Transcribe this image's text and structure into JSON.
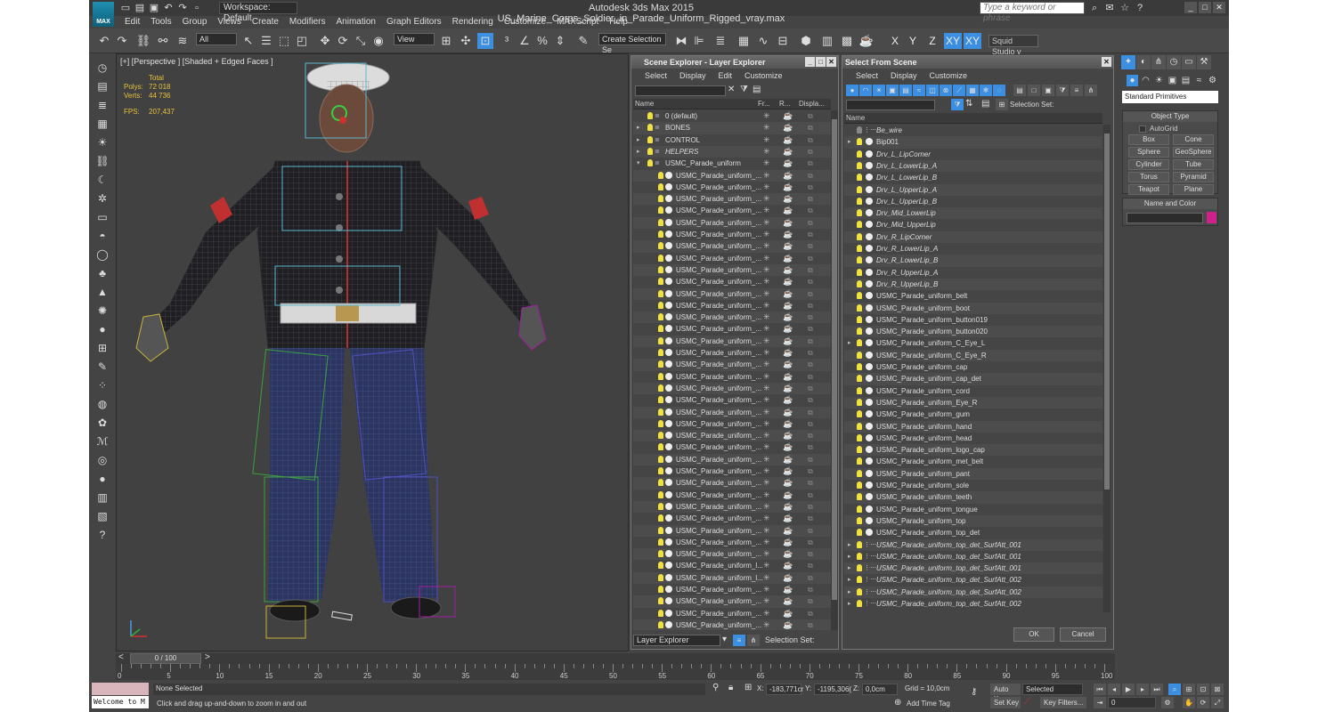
{
  "app": {
    "logo_text": "MAX",
    "workspace": "Workspace: Default",
    "window_title": "Autodesk 3ds Max  2015     US_Marine_Corps_Soldier_in_Parade_Uniform_Rigged_vray.max",
    "search_placeholder": "Type a keyword or phrase"
  },
  "menu": [
    "Edit",
    "Tools",
    "Group",
    "Views",
    "Create",
    "Modifiers",
    "Animation",
    "Graph Editors",
    "Rendering",
    "Customize",
    "MAXScript",
    "Help"
  ],
  "toolbar": {
    "filter": "All",
    "coord": "View",
    "selection_set": "Create Selection Se",
    "axes": [
      "X",
      "Y",
      "Z",
      "XY",
      "XY"
    ],
    "squid": "Squid Studio v"
  },
  "viewport": {
    "label": "[+] [Perspective ] [Shaded + Edged Faces ]",
    "stats_total": "Total",
    "polys_label": "Polys:",
    "polys": "72 018",
    "verts_label": "Verts:",
    "verts": "44 736",
    "fps_label": "FPS:",
    "fps": "207,437"
  },
  "scene_explorer": {
    "title": "Scene Explorer - Layer Explorer",
    "menu": [
      "Select",
      "Display",
      "Edit",
      "Customize"
    ],
    "columns": [
      "Name",
      "Fr...",
      "R...",
      "Displa..."
    ],
    "rows": [
      {
        "name": "0 (default)",
        "level": 0,
        "icon": "layer",
        "expand": false
      },
      {
        "name": "BONES",
        "level": 0,
        "icon": "layer",
        "expand": true
      },
      {
        "name": "CONTROL",
        "level": 0,
        "icon": "layer",
        "expand": true
      },
      {
        "name": "HELPERS",
        "level": 0,
        "icon": "layer",
        "expand": true,
        "italic": true
      },
      {
        "name": "USMC_Parade_uniform",
        "level": 0,
        "icon": "layer",
        "expand": true,
        "open": true
      },
      {
        "name": "USMC_Parade_uniform_...",
        "level": 1
      },
      {
        "name": "USMC_Parade_uniform_...",
        "level": 1
      },
      {
        "name": "USMC_Parade_uniform_...",
        "level": 1
      },
      {
        "name": "USMC_Parade_uniform_...",
        "level": 1
      },
      {
        "name": "USMC_Parade_uniform_...",
        "level": 1
      },
      {
        "name": "USMC_Parade_uniform_...",
        "level": 1
      },
      {
        "name": "USMC_Parade_uniform_...",
        "level": 1
      },
      {
        "name": "USMC_Parade_uniform_...",
        "level": 1
      },
      {
        "name": "USMC_Parade_uniform_...",
        "level": 1
      },
      {
        "name": "USMC_Parade_uniform_...",
        "level": 1
      },
      {
        "name": "USMC_Parade_uniform_...",
        "level": 1
      },
      {
        "name": "USMC_Parade_uniform_...",
        "level": 1
      },
      {
        "name": "USMC_Parade_uniform_...",
        "level": 1
      },
      {
        "name": "USMC_Parade_uniform_...",
        "level": 1
      },
      {
        "name": "USMC_Parade_uniform_...",
        "level": 1
      },
      {
        "name": "USMC_Parade_uniform_...",
        "level": 1
      },
      {
        "name": "USMC_Parade_uniform_...",
        "level": 1
      },
      {
        "name": "USMC_Parade_uniform_...",
        "level": 1
      },
      {
        "name": "USMC_Parade_uniform_...",
        "level": 1
      },
      {
        "name": "USMC_Parade_uniform_...",
        "level": 1
      },
      {
        "name": "USMC_Parade_uniform_...",
        "level": 1
      },
      {
        "name": "USMC_Parade_uniform_...",
        "level": 1
      },
      {
        "name": "USMC_Parade_uniform_...",
        "level": 1
      },
      {
        "name": "USMC_Parade_uniform_...",
        "level": 1
      },
      {
        "name": "USMC_Parade_uniform_...",
        "level": 1
      },
      {
        "name": "USMC_Parade_uniform_...",
        "level": 1
      },
      {
        "name": "USMC_Parade_uniform_...",
        "level": 1
      },
      {
        "name": "USMC_Parade_uniform_...",
        "level": 1
      },
      {
        "name": "USMC_Parade_uniform_...",
        "level": 1
      },
      {
        "name": "USMC_Parade_uniform_...",
        "level": 1
      },
      {
        "name": "USMC_Parade_uniform_...",
        "level": 1
      },
      {
        "name": "USMC_Parade_uniform_...",
        "level": 1
      },
      {
        "name": "USMC_Parade_uniform_...",
        "level": 1
      },
      {
        "name": "USMC_Parade_uniform_l...",
        "level": 1
      },
      {
        "name": "USMC_Parade_uniform_l...",
        "level": 1
      },
      {
        "name": "USMC_Parade_uniform_...",
        "level": 1
      },
      {
        "name": "USMC_Parade_uniform_...",
        "level": 1
      },
      {
        "name": "USMC_Parade_uniform_...",
        "level": 1
      },
      {
        "name": "USMC_Parade_uniform_...",
        "level": 1
      }
    ],
    "footer_dropdown": "Layer Explorer",
    "footer_selection": "Selection Set:"
  },
  "select_scene": {
    "title": "Select From Scene",
    "menu": [
      "Select",
      "Display",
      "Customize"
    ],
    "selection_set_label": "Selection Set:",
    "column": "Name",
    "rows": [
      {
        "name": "Be_wire",
        "italic": true,
        "kind": "helper"
      },
      {
        "name": "Bip001",
        "kind": "bone",
        "expand": true
      },
      {
        "name": "Drv_L_LipCorner",
        "italic": true,
        "kind": "bone"
      },
      {
        "name": "Drv_L_LowerLip_A",
        "italic": true,
        "kind": "bone"
      },
      {
        "name": "Drv_L_LowerLip_B",
        "italic": true,
        "kind": "bone"
      },
      {
        "name": "Drv_L_UpperLip_A",
        "italic": true,
        "kind": "bone"
      },
      {
        "name": "Drv_L_UpperLip_B",
        "italic": true,
        "kind": "bone"
      },
      {
        "name": "Drv_Mid_LowerLip",
        "italic": true,
        "kind": "bone"
      },
      {
        "name": "Drv_Mid_UpperLip",
        "italic": true,
        "kind": "bone"
      },
      {
        "name": "Drv_R_LipCorner",
        "italic": true,
        "kind": "bone"
      },
      {
        "name": "Drv_R_LowerLip_A",
        "italic": true,
        "kind": "bone"
      },
      {
        "name": "Drv_R_LowerLip_B",
        "italic": true,
        "kind": "bone"
      },
      {
        "name": "Drv_R_UpperLip_A",
        "italic": true,
        "kind": "bone"
      },
      {
        "name": "Drv_R_UpperLip_B",
        "italic": true,
        "kind": "bone"
      },
      {
        "name": "USMC_Parade_uniform_belt",
        "kind": "mesh"
      },
      {
        "name": "USMC_Parade_uniform_boot",
        "kind": "mesh"
      },
      {
        "name": "USMC_Parade_uniform_button019",
        "kind": "mesh"
      },
      {
        "name": "USMC_Parade_uniform_button020",
        "kind": "mesh"
      },
      {
        "name": "USMC_Parade_uniform_C_Eye_L",
        "kind": "mesh",
        "expand": true
      },
      {
        "name": "USMC_Parade_uniform_C_Eye_R",
        "kind": "mesh"
      },
      {
        "name": "USMC_Parade_uniform_cap",
        "kind": "mesh"
      },
      {
        "name": "USMC_Parade_uniform_cap_det",
        "kind": "mesh"
      },
      {
        "name": "USMC_Parade_uniform_cord",
        "kind": "mesh"
      },
      {
        "name": "USMC_Parade_uniform_Eye_R",
        "kind": "mesh"
      },
      {
        "name": "USMC_Parade_uniform_gum",
        "kind": "mesh"
      },
      {
        "name": "USMC_Parade_uniform_hand",
        "kind": "mesh"
      },
      {
        "name": "USMC_Parade_uniform_head",
        "kind": "mesh"
      },
      {
        "name": "USMC_Parade_uniform_logo_cap",
        "kind": "mesh"
      },
      {
        "name": "USMC_Parade_uniform_met_belt",
        "kind": "mesh"
      },
      {
        "name": "USMC_Parade_uniform_pant",
        "kind": "mesh"
      },
      {
        "name": "USMC_Parade_uniform_sole",
        "kind": "mesh"
      },
      {
        "name": "USMC_Parade_uniform_teeth",
        "kind": "mesh"
      },
      {
        "name": "USMC_Parade_uniform_tongue",
        "kind": "mesh"
      },
      {
        "name": "USMC_Parade_uniform_top",
        "kind": "mesh"
      },
      {
        "name": "USMC_Parade_uniform_top_det",
        "kind": "mesh"
      },
      {
        "name": "USMC_Parade_uniform_top_det_SurfAtt_001",
        "italic": true,
        "kind": "ref",
        "expand": true
      },
      {
        "name": "USMC_Parade_uniform_top_det_SurfAtt_001",
        "italic": true,
        "kind": "ref",
        "expand": true
      },
      {
        "name": "USMC_Parade_uniform_top_det_SurfAtt_001",
        "italic": true,
        "kind": "ref",
        "expand": true
      },
      {
        "name": "USMC_Parade_uniform_top_det_SurfAtt_002",
        "italic": true,
        "kind": "ref",
        "expand": true
      },
      {
        "name": "USMC_Parade_uniform_top_det_SurfAtt_002",
        "italic": true,
        "kind": "ref",
        "expand": true
      },
      {
        "name": "USMC_Parade_uniform_top_det_SurfAtt_002",
        "italic": true,
        "kind": "ref",
        "expand": true
      }
    ],
    "ok": "OK",
    "cancel": "Cancel"
  },
  "command_panel": {
    "category": "Standard Primitives",
    "object_type": "Object Type",
    "autogrid": "AutoGrid",
    "objects": [
      "Box",
      "Cone",
      "Sphere",
      "GeoSphere",
      "Cylinder",
      "Tube",
      "Torus",
      "Pyramid",
      "Teapot",
      "Plane"
    ],
    "name_and_color": "Name and Color",
    "object_color": "#d0208a"
  },
  "timeline": {
    "frame_slider": "0 / 100",
    "ticks": [
      0,
      5,
      10,
      15,
      20,
      25,
      30,
      35,
      40,
      45,
      50,
      55,
      60,
      65,
      70,
      75,
      80,
      85,
      90,
      95,
      100
    ]
  },
  "status": {
    "maxscript": "Welcome to M",
    "none_selected": "None Selected",
    "prompt": "Click and drag up-and-down to zoom in and out",
    "x_label": "X:",
    "x": "-183,771cr",
    "y_label": "Y:",
    "y": "-1195,306(",
    "z_label": "Z:",
    "z": "0,0cm",
    "grid": "Grid = 10,0cm",
    "add_time_tag": "Add Time Tag",
    "auto_key": "Auto Key",
    "selected": "Selected",
    "set_key": "Set Key",
    "key_filters": "Key Filters...",
    "frame": "0"
  }
}
